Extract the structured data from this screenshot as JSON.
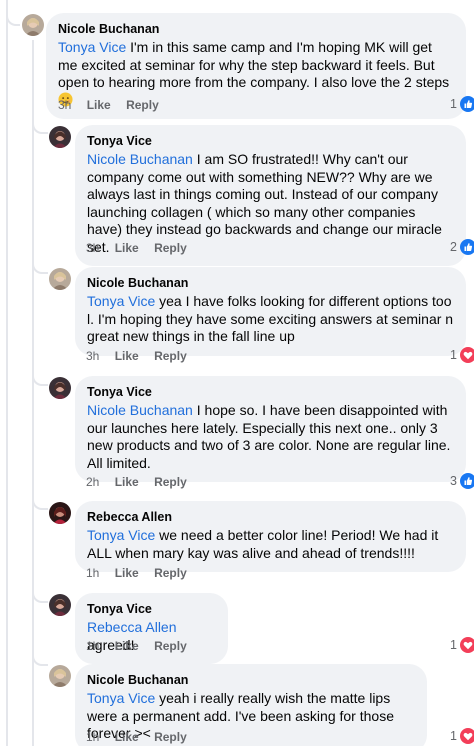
{
  "comments": [
    {
      "author": "Nicole Buchanan",
      "mention": "Tonya Vice",
      "text": " I'm in this same camp and I'm hoping MK will get me excited at seminar for why the step backward it feels. But open to hearing more from the company. I also love the 2 steps ",
      "emoji": "smiling-face",
      "time": "3h",
      "like": "Like",
      "reply": "Reply",
      "reaction_count": "1",
      "reaction_type": "like"
    },
    {
      "author": "Tonya Vice",
      "mention": "Nicole Buchanan",
      "text": " I am SO frustrated!! Why can't our company come out with something NEW?? Why are we always last in things coming out. Instead of our company launching collagen ( which so many other companies have) they instead go backwards and change our miracle set.",
      "time": "3h",
      "like": "Like",
      "reply": "Reply",
      "reaction_count": "2",
      "reaction_type": "like"
    },
    {
      "author": "Nicole Buchanan",
      "mention": "Tonya Vice",
      "text": " yea I have folks looking for different options too l. I'm hoping they have some exciting answers at seminar n great new things in the fall line up",
      "time": "3h",
      "like": "Like",
      "reply": "Reply",
      "reaction_count": "1",
      "reaction_type": "love"
    },
    {
      "author": "Tonya Vice",
      "mention": "Nicole Buchanan",
      "text": " I hope so. I have been disappointed with our launches here lately. Especially this next one.. only 3 new products and two of 3 are color. None are regular line. All limited.",
      "time": "2h",
      "like": "Like",
      "reply": "Reply",
      "reaction_count": "3",
      "reaction_type": "like"
    },
    {
      "author": "Rebecca Allen",
      "mention": "Tonya Vice",
      "text": " we need a better color line! Period! We had it ALL when mary kay was alive and ahead of trends!!!!",
      "time": "1h",
      "like": "Like",
      "reply": "Reply"
    },
    {
      "author": "Tonya Vice",
      "mention": "Rebecca Allen",
      "text": " agreed!",
      "time": "1h",
      "like": "Like",
      "reply": "Reply",
      "reaction_count": "1",
      "reaction_type": "love"
    },
    {
      "author": "Nicole Buchanan",
      "mention": "Tonya Vice",
      "text": " yeah i really really wish the matte lips were a permanent add. I've been asking for those forever ><",
      "time": "1h",
      "like": "Like",
      "reply": "Reply",
      "reaction_count": "1",
      "reaction_type": "love"
    }
  ],
  "colors": {
    "bubble": "#f0f2f5",
    "mention": "#216fdb",
    "like_blue": "#1877f2",
    "love_red": "#f33e58",
    "meta_gray": "#65676b"
  }
}
